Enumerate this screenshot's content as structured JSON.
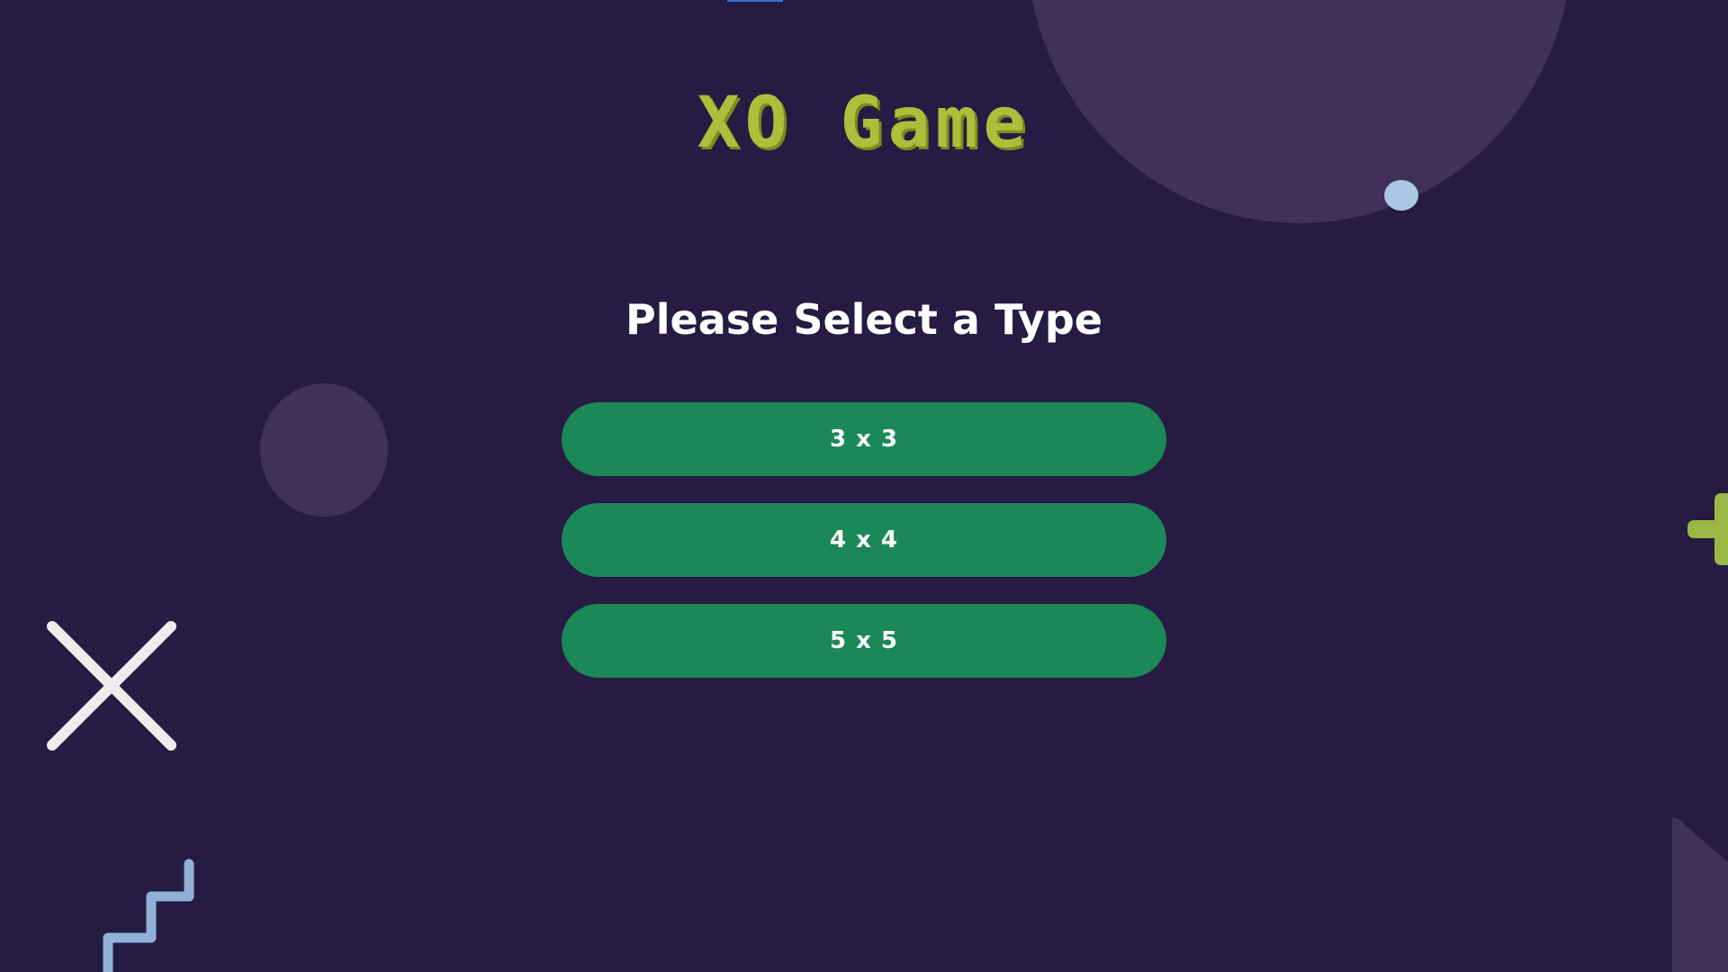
{
  "game": {
    "title": "XO Game",
    "subtitle": "Please Select a Type"
  },
  "board_types": [
    {
      "label": "3 x 3"
    },
    {
      "label": "4 x 4"
    },
    {
      "label": "5 x 5"
    }
  ],
  "colors": {
    "background": "#261b42",
    "decor_shape": "#412f5c",
    "title": "#afbe3a",
    "button": "#1b8858",
    "button_text": "#ffffff",
    "x_mark": "#f0ecee",
    "dot": "#a8c8e6",
    "zigzag": "#8fb1d8",
    "plus": "#9ab845"
  },
  "icons": {
    "x_mark": "x-mark-icon",
    "plus": "plus-shape-icon",
    "zigzag": "zigzag-line-icon"
  }
}
